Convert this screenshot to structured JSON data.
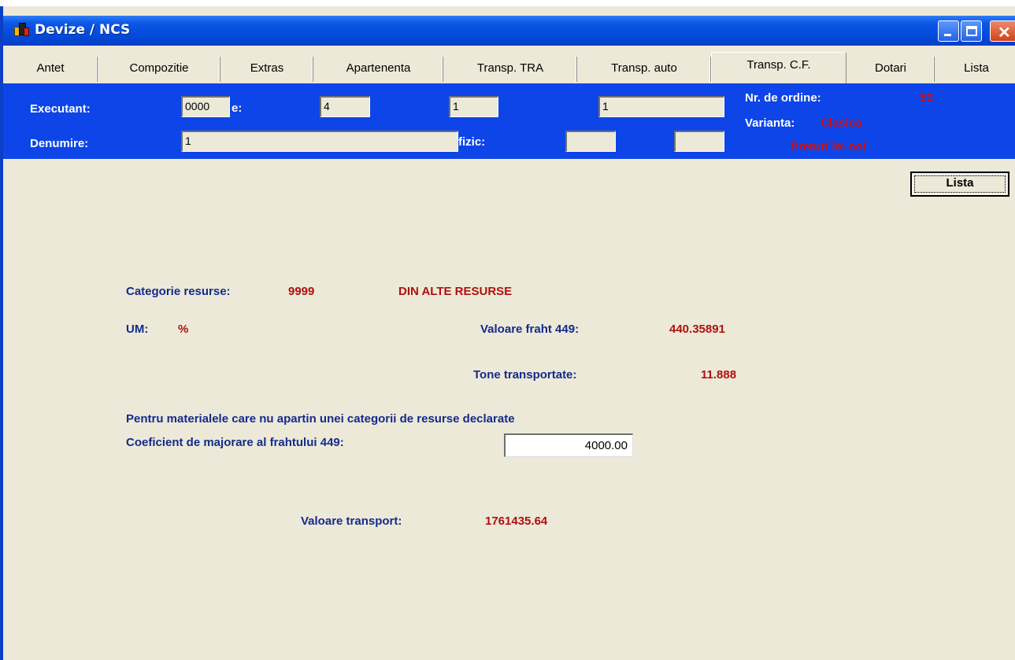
{
  "window": {
    "title": "Devize / NCS"
  },
  "tabs": [
    {
      "label": "Antet"
    },
    {
      "label": "Compozitie"
    },
    {
      "label": "Extras"
    },
    {
      "label": "Apartenenta"
    },
    {
      "label": "Transp. TRA"
    },
    {
      "label": "Transp. auto"
    },
    {
      "label": "Transp. C.F."
    },
    {
      "label": "Dotari"
    },
    {
      "label": "Lista"
    }
  ],
  "header": {
    "executant_label": "Executant:",
    "executant_value": "0000",
    "partial_label_1": "e:",
    "field2_value": "4",
    "field3_value": "1",
    "field4_value": "1",
    "denumire_label": "Denumire:",
    "denumire_value": "1",
    "fizic_label": "fizic:",
    "nr_ordine_label": "Nr. de ordine:",
    "nr_ordine_value": "53",
    "varianta_label": "Varianta:",
    "varianta_value": "Clasica",
    "preturi_text": "Preturi lei noi"
  },
  "content": {
    "lista_button": "Lista",
    "categorie_label": "Categorie resurse:",
    "categorie_code": "9999",
    "categorie_name": "DIN ALTE RESURSE",
    "um_label": "UM:",
    "um_value": "%",
    "valoare_fraht_label": "Valoare fraht 449:",
    "valoare_fraht_value": "440.35891",
    "tone_label": "Tone transportate:",
    "tone_value": "11.888",
    "note_text": "Pentru materialele care nu apartin unei categorii de resurse declarate",
    "coef_label": "Coeficient de majorare al frahtului 449:",
    "coef_value": "4000.00",
    "valoare_transport_label": "Valoare transport:",
    "valoare_transport_value": "1761435.64"
  }
}
